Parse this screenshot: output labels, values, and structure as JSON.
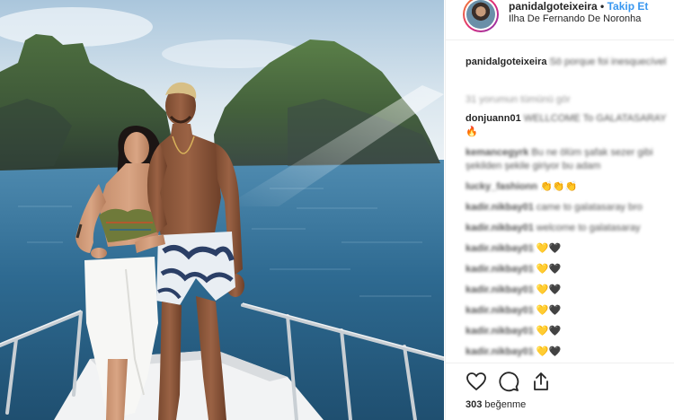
{
  "post": {
    "username": "panidalgoteixeira",
    "separator": "•",
    "follow_label": "Takip Et",
    "location": "Ilha De Fernando De Noronha"
  },
  "caption": {
    "user": "panidalgoteixeira",
    "text": "Sö porque foi inesquecível"
  },
  "view_all_label": "31 yorumun tümünü gör",
  "comments": [
    {
      "user": "donjuann01",
      "text": "WELLCOME To GALATASARAY",
      "emoji": "🔥"
    },
    {
      "user": "kemancegyrk",
      "text": "Bu ne ölüm şafak sezer gibi şekilden şekile giriyor bu adam",
      "emoji": ""
    },
    {
      "user": "lucky_fashionn",
      "text": "",
      "emoji": "👏👏👏"
    },
    {
      "user": "kadir.nikbay01",
      "text": "came to galatasaray bro",
      "emoji": ""
    },
    {
      "user": "kadir.nikbay01",
      "text": "welcome to galatasaray",
      "emoji": ""
    },
    {
      "user": "kadir.nikbay01",
      "text": "",
      "emoji": "💛🖤"
    },
    {
      "user": "kadir.nikbay01",
      "text": "",
      "emoji": "💛🖤"
    },
    {
      "user": "kadir.nikbay01",
      "text": "",
      "emoji": "💛🖤"
    },
    {
      "user": "kadir.nikbay01",
      "text": "",
      "emoji": "💛🖤"
    },
    {
      "user": "kadir.nikbay01",
      "text": "",
      "emoji": "💛🖤"
    },
    {
      "user": "kadir.nikbay01",
      "text": "",
      "emoji": "💛🖤"
    }
  ],
  "actions": {
    "like_icon": "heart-icon",
    "comment_icon": "comment-icon",
    "share_icon": "share-icon"
  },
  "likes": {
    "count": "303",
    "label": "beğenme"
  },
  "colors": {
    "link_blue": "#3897f0",
    "text": "#262626",
    "muted": "#999999",
    "sea": "#2f6f95",
    "sky": "#c9dbe8"
  }
}
